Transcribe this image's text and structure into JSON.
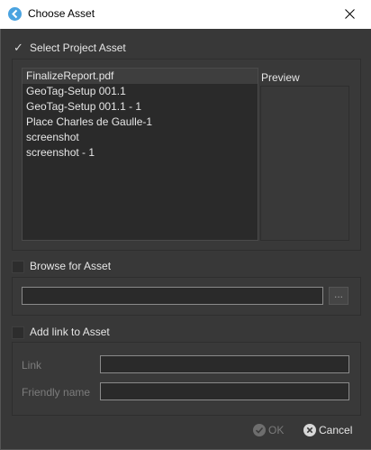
{
  "window": {
    "title": "Choose Asset",
    "icon": "app-logo-icon",
    "close_icon": "close-icon"
  },
  "project_asset": {
    "label": "Select Project Asset",
    "checked": true,
    "checkmark": "✓",
    "items": [
      "FinalizeReport.pdf",
      "GeoTag-Setup  001.1",
      "GeoTag-Setup  001.1 - 1",
      "Place Charles de Gaulle-1",
      "screenshot",
      "screenshot - 1"
    ],
    "selected_index": 0,
    "preview_label": "Preview"
  },
  "browse": {
    "label": "Browse for Asset",
    "checked": false,
    "path_value": "",
    "button_label": "..."
  },
  "link": {
    "label": "Add link to Asset",
    "checked": false,
    "link_label": "Link",
    "link_value": "",
    "friendly_label": "Friendly name",
    "friendly_value": ""
  },
  "buttons": {
    "ok_label": "OK",
    "ok_enabled": false,
    "cancel_label": "Cancel"
  },
  "colors": {
    "background": "#383838",
    "accent": "#4aa3e0",
    "text": "#e6e6e6",
    "disabled_text": "#7a7a7a"
  }
}
